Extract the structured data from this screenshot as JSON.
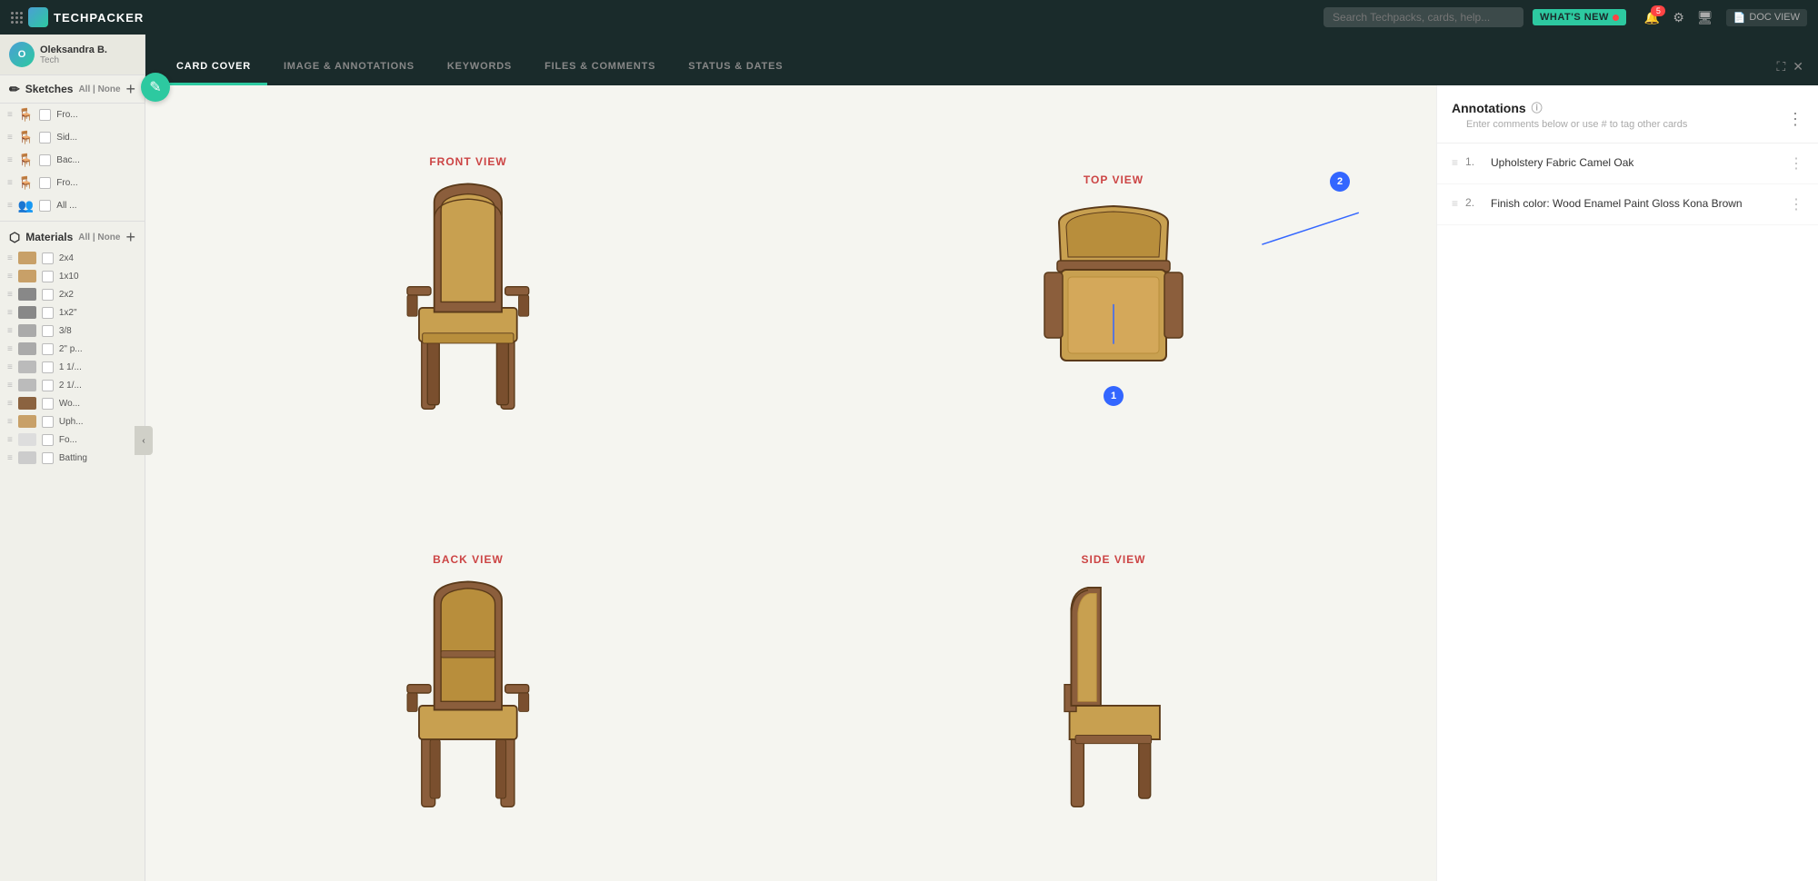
{
  "topbar": {
    "app_name": "TECHPACKER",
    "search_placeholder": "Search Techpacks, cards, help...",
    "whats_new_label": "WHAT'S NEW",
    "notification_count": "5",
    "doc_view_label": "DOC VIEW"
  },
  "tabs": [
    {
      "id": "card-cover",
      "label": "CARD COVER",
      "active": true
    },
    {
      "id": "image-annotations",
      "label": "IMAGE & ANNOTATIONS",
      "active": false
    },
    {
      "id": "keywords",
      "label": "KEYWORDS",
      "active": false
    },
    {
      "id": "files-comments",
      "label": "FILES & COMMENTS",
      "active": false
    },
    {
      "id": "status-dates",
      "label": "STATUS & DATES",
      "active": false
    }
  ],
  "sidebar": {
    "user_name": "Oleksandra B.",
    "user_tag": "Tech",
    "sketches_label": "Sketches",
    "sketches_filter": "All | None",
    "add_sketch_label": "+ ADD SKETCH",
    "sketches": [
      {
        "label": "Fro..."
      },
      {
        "label": "Sid..."
      },
      {
        "label": "Bac..."
      },
      {
        "label": "Fro..."
      },
      {
        "label": "All ..."
      }
    ],
    "materials_label": "Materials",
    "materials_filter": "All | None",
    "add_material_label": "+ ADD MATERIAL",
    "materials": [
      {
        "label": "2x4",
        "color": "#c8a068"
      },
      {
        "label": "1x10",
        "color": "#c8a068"
      },
      {
        "label": "2x2",
        "color": "#888"
      },
      {
        "label": "1x2\"",
        "color": "#888"
      },
      {
        "label": "3/8",
        "color": "#aaa"
      },
      {
        "label": "2\" p...",
        "color": "#aaa"
      },
      {
        "label": "1 1/...",
        "color": "#bbb"
      },
      {
        "label": "2 1/...",
        "color": "#bbb"
      },
      {
        "label": "Wo...",
        "color": "#8B6340"
      },
      {
        "label": "Uph...",
        "color": "#c8a068"
      },
      {
        "label": "Fo...",
        "color": "#ddd"
      },
      {
        "label": "Batting",
        "color": "#ccc"
      }
    ]
  },
  "annotations": {
    "title": "Annotations",
    "subtitle": "Enter comments below or use # to tag other cards",
    "items": [
      {
        "num": "1.",
        "text": "Upholstery Fabric Camel Oak"
      },
      {
        "num": "2.",
        "text": "Finish color: Wood Enamel Paint Gloss Kona Brown"
      }
    ]
  },
  "views": [
    {
      "id": "front-view",
      "label": "FRONT VIEW"
    },
    {
      "id": "top-view",
      "label": "TOP VIEW"
    },
    {
      "id": "back-view",
      "label": "BACK VIEW"
    },
    {
      "id": "side-view",
      "label": "SIDE VIEW"
    }
  ],
  "colors": {
    "accent": "#2dc9a0",
    "topbar_bg": "#1a2b2b",
    "chair_wood": "#8B5E3C",
    "chair_upholstery": "#C8A050",
    "annotation_blue": "#3366ff",
    "view_label_red": "#cc4444"
  }
}
